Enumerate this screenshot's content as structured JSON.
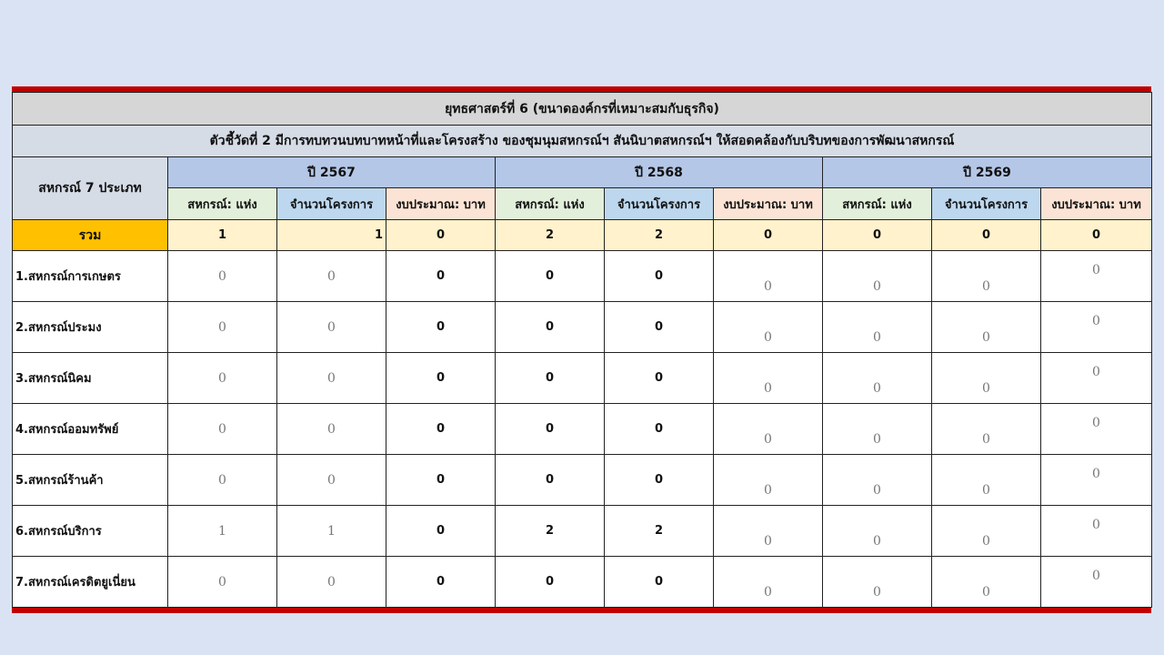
{
  "title": "ยุทธศาสตร์ที่ 6 (ขนาดองค์กรที่เหมาะสมกับธุรกิจ)",
  "subtitle": "ตัวชี้วัดที่ 2 มีการทบทวนบทบาทหน้าที่และโครงสร้าง ของชุมนุมสหกรณ์ฯ สันนิบาตสหกรณ์ฯ ให้สอดคล้องกับบริบทของการพัฒนาสหกรณ์",
  "corner_label": "สหกรณ์ 7 ประเภท",
  "years": [
    "ปี 2567",
    "ปี 2568",
    "ปี 2569"
  ],
  "subheaders": [
    "สหกรณ์: แห่ง",
    "จำนวนโครงการ",
    "งบประมาณ: บาท"
  ],
  "total": {
    "label": "รวม",
    "values": [
      "1",
      "1",
      "0",
      "2",
      "2",
      "0",
      "0",
      "0",
      "0"
    ]
  },
  "rows": [
    {
      "label": "1.สหกรณ์การเกษตร",
      "values": [
        "0",
        "0",
        "0",
        "0",
        "0",
        "0",
        "0",
        "0",
        "0"
      ]
    },
    {
      "label": "2.สหกรณ์ประมง",
      "values": [
        "0",
        "0",
        "0",
        "0",
        "0",
        "0",
        "0",
        "0",
        "0"
      ]
    },
    {
      "label": "3.สหกรณ์นิคม",
      "values": [
        "0",
        "0",
        "0",
        "0",
        "0",
        "0",
        "0",
        "0",
        "0"
      ]
    },
    {
      "label": "4.สหกรณ์ออมทรัพย์",
      "values": [
        "0",
        "0",
        "0",
        "0",
        "0",
        "0",
        "0",
        "0",
        "0"
      ]
    },
    {
      "label": "5.สหกรณ์ร้านค้า",
      "values": [
        "0",
        "0",
        "0",
        "0",
        "0",
        "0",
        "0",
        "0",
        "0"
      ]
    },
    {
      "label": "6.สหกรณ์บริการ",
      "values": [
        "1",
        "1",
        "0",
        "2",
        "2",
        "0",
        "0",
        "0",
        "0"
      ]
    },
    {
      "label": "7.สหกรณ์เครดิตยูเนี่ยน",
      "values": [
        "0",
        "0",
        "0",
        "0",
        "0",
        "0",
        "0",
        "0",
        "0"
      ]
    }
  ],
  "colors": {
    "frame_red": "#c00000",
    "total_label_bg": "#ffc000",
    "total_row_bg": "#fff2cc",
    "year_bg": "#b4c7e7",
    "unit_bg": "#e2efda",
    "project_bg": "#bdd7ee",
    "budget_bg": "#fbe4d5"
  }
}
